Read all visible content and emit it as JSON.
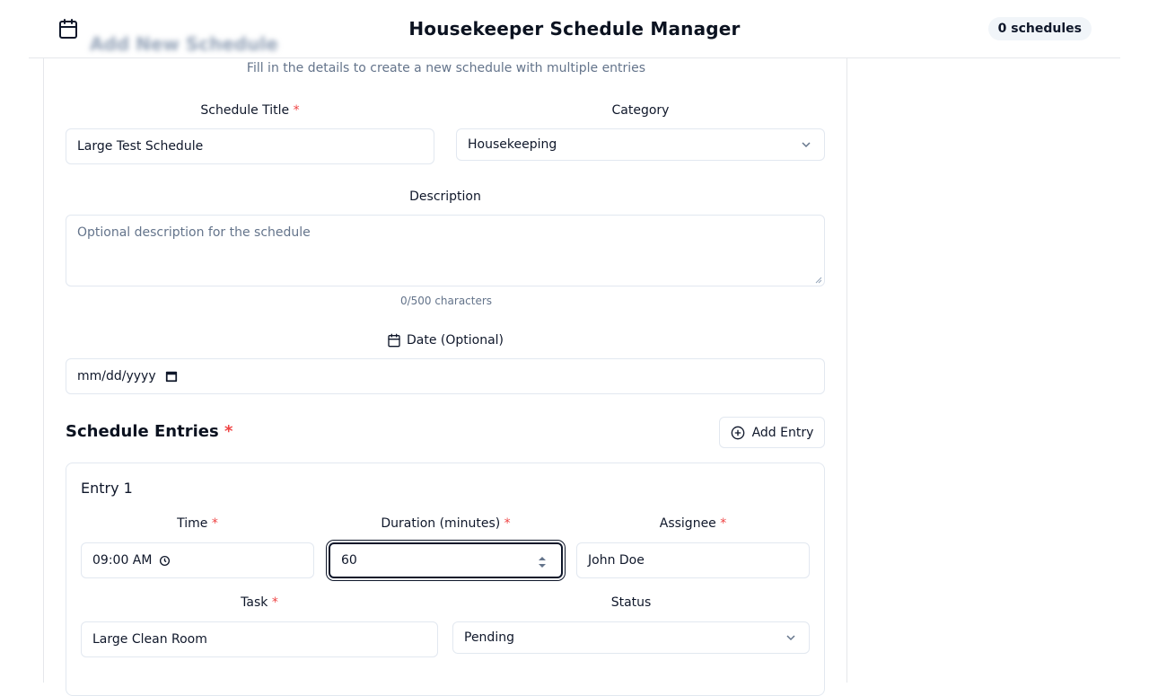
{
  "header": {
    "title": "Housekeeper Schedule Manager",
    "badge": "0 schedules"
  },
  "form": {
    "heading": "Add New Schedule",
    "subtitle": "Fill in the details to create a new schedule with multiple entries",
    "schedule_title_label": "Schedule Title",
    "schedule_title_value": "Large Test Schedule",
    "category_label": "Category",
    "category_value": "Housekeeping",
    "description_label": "Description",
    "description_placeholder": "Optional description for the schedule",
    "description_counter": "0/500 characters",
    "date_label": "Date (Optional)",
    "date_placeholder": "mm/dd/yyyy",
    "required_mark": "*"
  },
  "entries_section": {
    "title": "Schedule Entries",
    "add_entry_label": "Add Entry"
  },
  "entries": [
    {
      "title": "Entry 1",
      "time_label": "Time",
      "time_value": "09:00 AM",
      "duration_label": "Duration (minutes)",
      "duration_value": "60",
      "assignee_label": "Assignee",
      "assignee_value": "John Doe",
      "task_label": "Task",
      "task_value": "Large Clean Room",
      "status_label": "Status",
      "status_value": "Pending"
    }
  ],
  "colors": {
    "required": "#ef4444",
    "border": "#e2e8f0",
    "muted": "#64748b"
  }
}
